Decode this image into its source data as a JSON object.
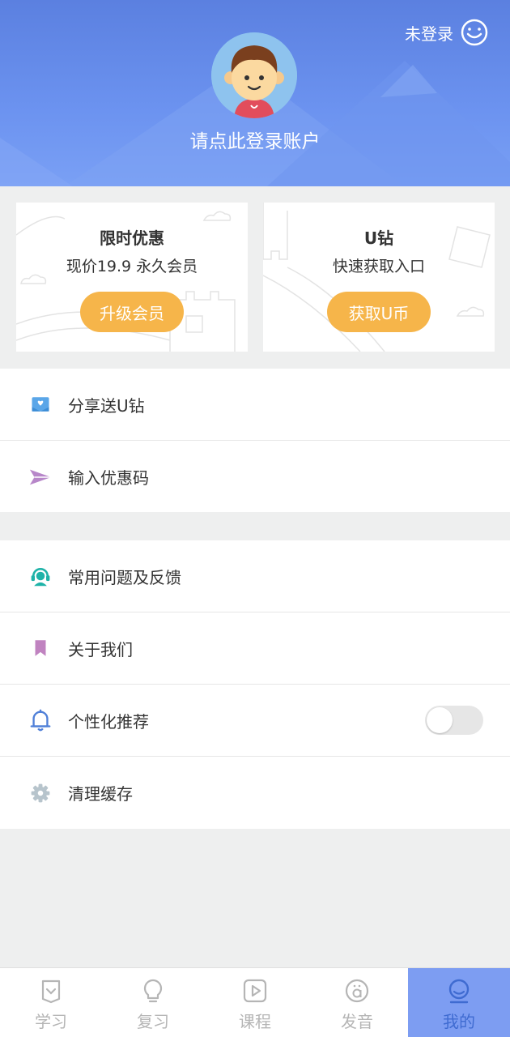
{
  "header": {
    "login_status": "未登录",
    "login_prompt": "请点此登录账户"
  },
  "promos": [
    {
      "title": "限时优惠",
      "subtitle": "现价19.9  永久会员",
      "button": "升级会员"
    },
    {
      "title": "U钻",
      "subtitle": "快速获取入口",
      "button": "获取U币"
    }
  ],
  "menu_group_1": [
    {
      "label": "分享送U钻",
      "icon": "gift-icon"
    },
    {
      "label": "输入优惠码",
      "icon": "paper-plane-icon"
    }
  ],
  "menu_group_2": [
    {
      "label": "常用问题及反馈",
      "icon": "support-icon"
    },
    {
      "label": "关于我们",
      "icon": "bookmark-icon"
    },
    {
      "label": "个性化推荐",
      "icon": "bell-icon",
      "toggle": false
    },
    {
      "label": "清理缓存",
      "icon": "gear-icon"
    }
  ],
  "tabs": [
    {
      "label": "学习",
      "icon": "book-icon",
      "active": false
    },
    {
      "label": "复习",
      "icon": "lightbulb-icon",
      "active": false
    },
    {
      "label": "课程",
      "icon": "play-icon",
      "active": false
    },
    {
      "label": "发音",
      "icon": "pronunciation-icon",
      "active": false
    },
    {
      "label": "我的",
      "icon": "profile-icon",
      "active": true
    }
  ],
  "colors": {
    "header_blue": "#5b80e0",
    "accent_orange": "#f6b54a",
    "active_tab": "#7d9df2"
  }
}
